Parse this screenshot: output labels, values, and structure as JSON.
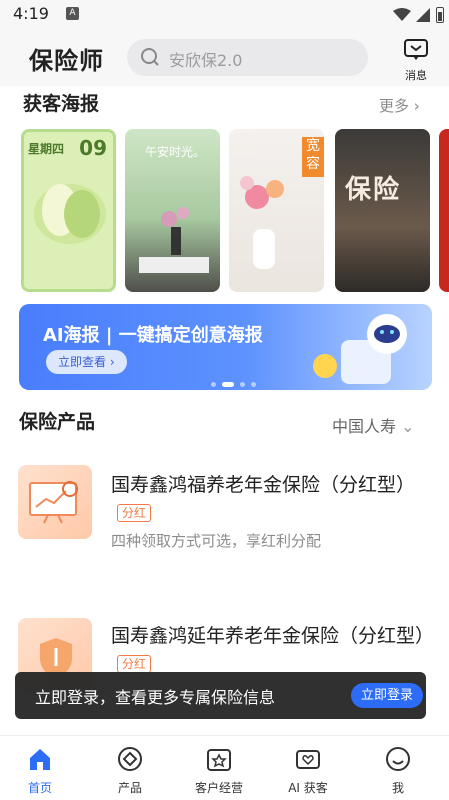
{
  "status": {
    "time": "4:19",
    "notification": "A"
  },
  "header": {
    "title": "保险师",
    "search_placeholder": "安欣保2.0",
    "message_label": "消息"
  },
  "posters_section": {
    "title": "获客海报",
    "more": "更多",
    "posters": [
      {
        "text": "星期四",
        "date_big": "09"
      },
      {
        "text": "午安时光。"
      },
      {
        "text": "宽容"
      },
      {
        "text": "保险"
      },
      {
        "text": ""
      }
    ]
  },
  "banner": {
    "title": "AI海报 | 一键搞定创意海报",
    "button": "立即查看 ›"
  },
  "products_section": {
    "title": "保险产品",
    "company": "中国人寿",
    "items": [
      {
        "name": "国寿鑫鸿福养老年金保险（分红型）",
        "tag": "分红",
        "desc": "四种领取方式可选，享红利分配"
      },
      {
        "name": "国寿鑫鸿延年养老年金保险（分红型）",
        "tag": "分红",
        "desc": ""
      }
    ]
  },
  "toast": {
    "text": "立即登录，查看更多专属保险信息",
    "button": "立即登录"
  },
  "tabbar": [
    {
      "label": "首页",
      "icon": "home-icon",
      "active": true
    },
    {
      "label": "产品",
      "icon": "product-icon",
      "active": false
    },
    {
      "label": "客户经营",
      "icon": "customer-icon",
      "active": false
    },
    {
      "label": "AI 获客",
      "icon": "ai-icon",
      "active": false
    },
    {
      "label": "我",
      "icon": "me-icon",
      "active": false
    }
  ],
  "colors": {
    "accent": "#2d6cf6",
    "tag": "#f27a45",
    "banner": "#4a7dfc"
  }
}
